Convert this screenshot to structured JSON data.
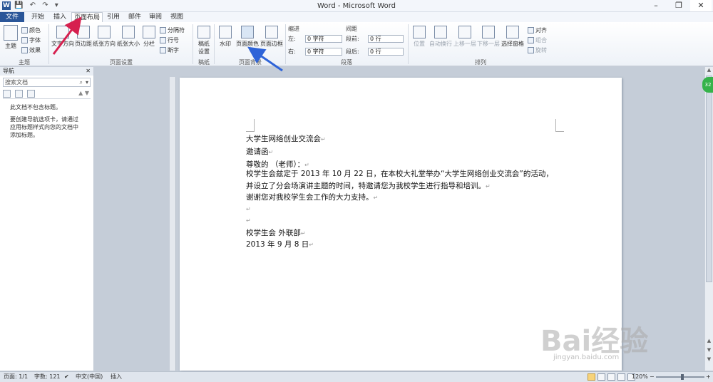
{
  "window": {
    "app_letter": "W",
    "title": "Word - Microsoft Word",
    "controls": {
      "minimize": "–",
      "restore": "❐",
      "close": "✕"
    }
  },
  "qat": {
    "save": "💾",
    "undo": "↶",
    "redo": "↷",
    "dropdown": "▾"
  },
  "tabs": [
    "文件",
    "开始",
    "插入",
    "页面布局",
    "引用",
    "邮件",
    "审阅",
    "视图"
  ],
  "active_tab": "页面布局",
  "ribbon": {
    "themes": {
      "theme": "主题",
      "colors": "颜色",
      "fonts": "字体",
      "effects": "效果",
      "group": "主题"
    },
    "page_setup": {
      "text_direction": "文字方向",
      "margins": "页边距",
      "orientation": "纸张方向",
      "size": "纸张大小",
      "columns": "分栏",
      "breaks": "分隔符",
      "line_numbers": "行号",
      "hyphenation": "断字",
      "group": "页面设置"
    },
    "draft": {
      "settings": "稿纸\n设置",
      "group": "稿纸"
    },
    "page_background": {
      "watermark": "水印",
      "page_color": "页面颜色",
      "page_borders": "页面边框",
      "group": "页面背景"
    },
    "paragraph": {
      "indent": "缩进",
      "left_label": "左:",
      "right_label": "右:",
      "left_value": "0 字符",
      "right_value": "0 字符",
      "spacing": "间距",
      "before_label": "段前:",
      "after_label": "段后:",
      "before_value": "0 行",
      "after_value": "0 行",
      "group": "段落"
    },
    "arrange": {
      "position": "位置",
      "wrap": "自动换行",
      "forward": "上移一层",
      "backward": "下移一层",
      "selection_pane": "选择窗格",
      "align": "对齐",
      "group_btn": "组合",
      "rotate": "旋转",
      "group": "排列"
    }
  },
  "nav_pane": {
    "title": "导航",
    "close": "✕",
    "search_placeholder": "搜索文档",
    "message1": "此文档不包含标题。",
    "message2": "要创建导航选项卡，请通过应用标题样式向您的文档中添加标题。"
  },
  "document": {
    "lines": [
      "大学生网络创业交流会",
      "邀请函",
      "尊敬的            （老师）：",
      "校学生会兹定于 2013 年 10 月 22 日，在本校大礼堂举办“大学生网络创业交流会”的活动，",
      "并设立了分会场演讲主题的时间，特邀请您为我校学生进行指导和培训。",
      "谢谢您对我校学生会工作的大力支持。",
      "",
      "",
      "校学生会  外联部",
      "2013 年 9 月 8 日"
    ],
    "para_mark": "↵"
  },
  "status": {
    "page": "页面: 1/1",
    "words": "字数: 121",
    "language": "中文(中国)",
    "mode": "插入",
    "zoom": "120%",
    "minus": "−",
    "plus": "+"
  },
  "scroll_badge": "32",
  "watermark": {
    "brand": "Bai经验",
    "url": "jingyan.baidu.com"
  },
  "colors": {
    "file_tab": "#2a5699",
    "arrow_red": "#d6204f",
    "arrow_blue": "#2f64d8",
    "badge": "#35b34a"
  }
}
